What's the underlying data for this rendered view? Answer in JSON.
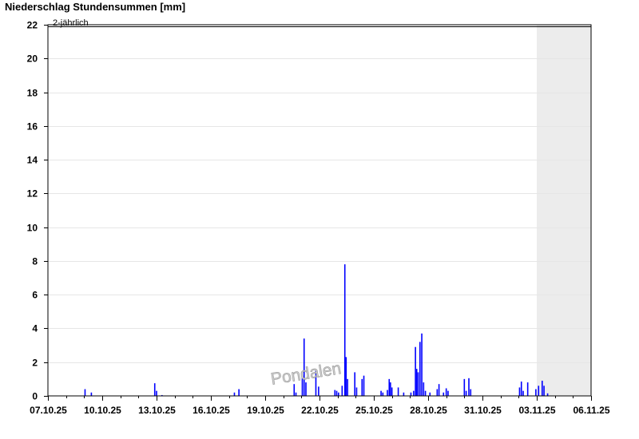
{
  "chart_data": {
    "type": "bar",
    "title": "Niederschlag Stundensummen [mm]",
    "xlabel": "",
    "ylabel": "",
    "ylim": [
      0,
      22
    ],
    "yticks": [
      0,
      2,
      4,
      6,
      8,
      10,
      12,
      14,
      16,
      18,
      20,
      22
    ],
    "x_start": "07.10.25",
    "x_end": "06.11.25",
    "x_unit": "days",
    "xtick_labels": [
      "07.10.25",
      "10.10.25",
      "13.10.25",
      "16.10.25",
      "19.10.25",
      "22.10.25",
      "25.10.25",
      "28.10.25",
      "31.10.25",
      "03.11.25",
      "06.11.25"
    ],
    "grid": true,
    "forecast_area": {
      "from": "03.11.25",
      "to": "06.11.25",
      "color": "#ececec"
    },
    "threshold": {
      "value": 22,
      "label": "2-jährlich"
    },
    "bar_color": "#0000ff",
    "watermark": "Pondalen",
    "series": [
      {
        "values": [
          {
            "x": 2.05,
            "y": 0.4
          },
          {
            "x": 2.4,
            "y": 0.2
          },
          {
            "x": 5.9,
            "y": 0.75
          },
          {
            "x": 6.0,
            "y": 0.3
          },
          {
            "x": 6.3,
            "y": 0.05
          },
          {
            "x": 10.3,
            "y": 0.2
          },
          {
            "x": 10.55,
            "y": 0.4
          },
          {
            "x": 13.6,
            "y": 0.7
          },
          {
            "x": 13.7,
            "y": 0.2
          },
          {
            "x": 14.05,
            "y": 1.2
          },
          {
            "x": 14.15,
            "y": 3.4
          },
          {
            "x": 14.25,
            "y": 0.8
          },
          {
            "x": 14.8,
            "y": 1.5
          },
          {
            "x": 14.95,
            "y": 0.55
          },
          {
            "x": 15.85,
            "y": 0.35
          },
          {
            "x": 15.95,
            "y": 0.3
          },
          {
            "x": 16.05,
            "y": 0.2
          },
          {
            "x": 16.25,
            "y": 0.6
          },
          {
            "x": 16.4,
            "y": 7.8
          },
          {
            "x": 16.47,
            "y": 2.3
          },
          {
            "x": 16.55,
            "y": 1.0
          },
          {
            "x": 16.95,
            "y": 1.4
          },
          {
            "x": 17.05,
            "y": 0.5
          },
          {
            "x": 17.35,
            "y": 1.0
          },
          {
            "x": 17.45,
            "y": 1.2
          },
          {
            "x": 18.4,
            "y": 0.3
          },
          {
            "x": 18.5,
            "y": 0.2
          },
          {
            "x": 18.75,
            "y": 0.35
          },
          {
            "x": 18.85,
            "y": 1.0
          },
          {
            "x": 18.92,
            "y": 0.8
          },
          {
            "x": 19.0,
            "y": 0.5
          },
          {
            "x": 19.35,
            "y": 0.5
          },
          {
            "x": 19.65,
            "y": 0.2
          },
          {
            "x": 20.05,
            "y": 0.2
          },
          {
            "x": 20.2,
            "y": 0.3
          },
          {
            "x": 20.3,
            "y": 2.9
          },
          {
            "x": 20.37,
            "y": 1.6
          },
          {
            "x": 20.45,
            "y": 1.4
          },
          {
            "x": 20.55,
            "y": 3.2
          },
          {
            "x": 20.65,
            "y": 3.7
          },
          {
            "x": 20.75,
            "y": 0.8
          },
          {
            "x": 20.85,
            "y": 0.3
          },
          {
            "x": 21.1,
            "y": 0.2
          },
          {
            "x": 21.5,
            "y": 0.4
          },
          {
            "x": 21.6,
            "y": 0.7
          },
          {
            "x": 21.85,
            "y": 0.2
          },
          {
            "x": 22.0,
            "y": 0.45
          },
          {
            "x": 22.1,
            "y": 0.3
          },
          {
            "x": 23.0,
            "y": 1.0
          },
          {
            "x": 23.1,
            "y": 0.3
          },
          {
            "x": 23.25,
            "y": 1.05
          },
          {
            "x": 23.35,
            "y": 0.4
          },
          {
            "x": 26.05,
            "y": 0.5
          },
          {
            "x": 26.15,
            "y": 0.85
          },
          {
            "x": 26.25,
            "y": 0.3
          },
          {
            "x": 26.5,
            "y": 0.8
          },
          {
            "x": 26.95,
            "y": 0.4
          },
          {
            "x": 27.1,
            "y": 0.6
          },
          {
            "x": 27.3,
            "y": 0.9
          },
          {
            "x": 27.4,
            "y": 0.6
          },
          {
            "x": 27.6,
            "y": 0.15
          }
        ]
      }
    ]
  }
}
